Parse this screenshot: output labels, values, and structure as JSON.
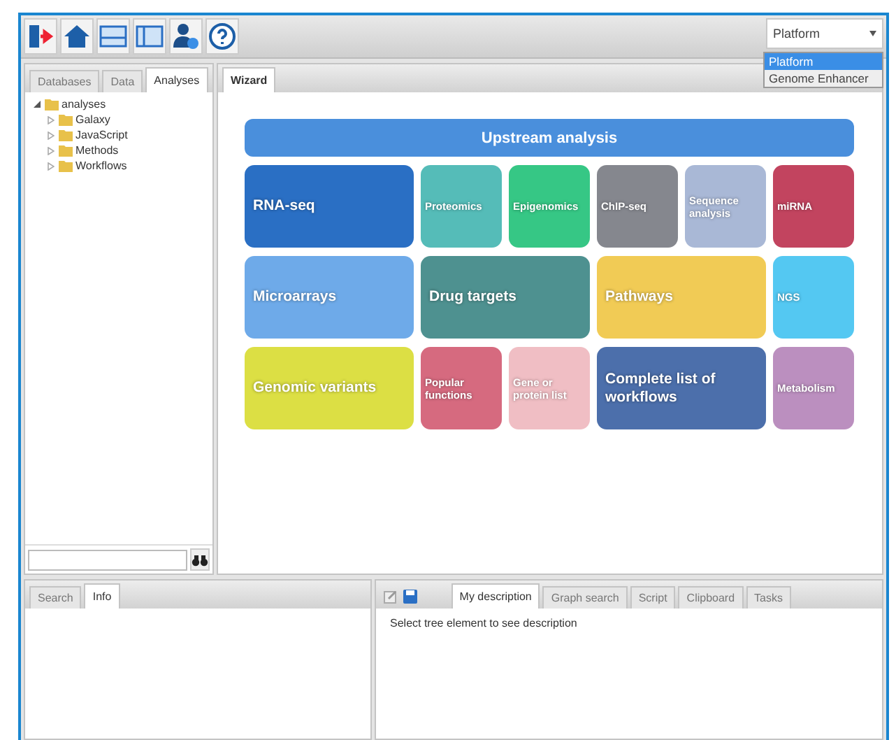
{
  "toolbar": {
    "buttons": [
      {
        "kind": "exit"
      },
      {
        "kind": "home"
      },
      {
        "kind": "rows"
      },
      {
        "kind": "columns"
      },
      {
        "kind": "user"
      },
      {
        "kind": "help"
      }
    ]
  },
  "platform_select": {
    "value": "Platform",
    "options": [
      {
        "label": "Platform",
        "selected": true
      },
      {
        "label": "Genome Enhancer",
        "selected": false
      }
    ]
  },
  "left_panel": {
    "tabs": [
      {
        "label": "Databases",
        "selected": false
      },
      {
        "label": "Data",
        "selected": false
      },
      {
        "label": "Analyses",
        "selected": true
      }
    ],
    "tree": [
      {
        "label": "analyses",
        "expanded": true,
        "children": [
          {
            "label": "Galaxy",
            "expanded": false
          },
          {
            "label": "JavaScript",
            "expanded": false
          },
          {
            "label": "Methods",
            "expanded": false
          },
          {
            "label": "Workflows",
            "expanded": false
          }
        ]
      }
    ]
  },
  "center_panel": {
    "tabs": [
      {
        "label": "Wizard",
        "selected": true
      }
    ],
    "header": "Upstream analysis",
    "tiles": [
      {
        "label": "RNA-seq",
        "kind": "wide",
        "color": "#2a6fc4"
      },
      {
        "label": "Proteomics",
        "kind": "small",
        "color": "#55bcb8"
      },
      {
        "label": "Epigenomics",
        "kind": "small",
        "color": "#36c785"
      },
      {
        "label": "ChIP-seq",
        "kind": "small",
        "color": "#85878e"
      },
      {
        "label": "Sequence analysis",
        "kind": "small",
        "color": "#a9b8d6"
      },
      {
        "label": "miRNA",
        "kind": "small",
        "color": "#c2445f"
      },
      {
        "label": "Microarrays",
        "kind": "wide",
        "color": "#6eaae9"
      },
      {
        "label": "Drug targets",
        "kind": "wide",
        "color": "#4e9190"
      },
      {
        "label": "Pathways",
        "kind": "wide",
        "color": "#f1cb55"
      },
      {
        "label": "NGS",
        "kind": "small",
        "color": "#54c8f2"
      },
      {
        "label": "Genomic variants",
        "kind": "wide",
        "color": "#dcdf44"
      },
      {
        "label": "Popular functions",
        "kind": "small",
        "color": "#d66a7f"
      },
      {
        "label": "Gene or protein list",
        "kind": "small",
        "color": "#f0bec4"
      },
      {
        "label": "Complete list of workflows",
        "kind": "wide",
        "color": "#4c6fab"
      },
      {
        "label": "Metabolism",
        "kind": "small",
        "color": "#bb8fbf"
      }
    ]
  },
  "bottom_left": {
    "tabs": [
      {
        "label": "Search",
        "selected": false
      },
      {
        "label": "Info",
        "selected": true
      }
    ]
  },
  "bottom_right": {
    "tabs": [
      {
        "label": "My description",
        "selected": true
      },
      {
        "label": "Graph search",
        "selected": false
      },
      {
        "label": "Script",
        "selected": false
      },
      {
        "label": "Clipboard",
        "selected": false
      },
      {
        "label": "Tasks",
        "selected": false
      }
    ],
    "message": "Select tree element to see description"
  }
}
